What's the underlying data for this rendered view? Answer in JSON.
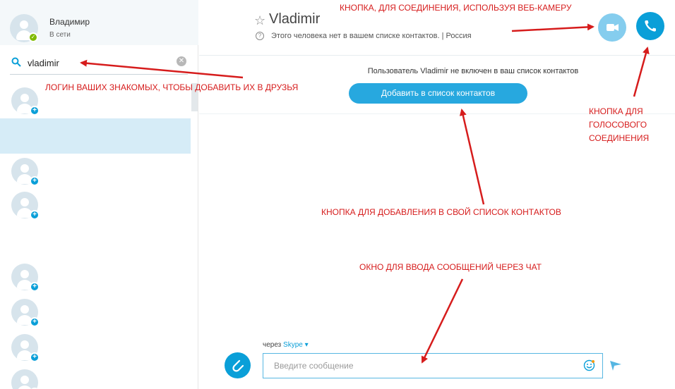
{
  "sidebar": {
    "profile": {
      "name": "Владимир",
      "status": "В сети"
    },
    "search": {
      "value": "vladimir",
      "placeholder": ""
    }
  },
  "header": {
    "contact_name": "Vladimir",
    "subtitle": "Этого человека нет в вашем списке контактов. | Россия"
  },
  "notice": {
    "text": "Пользователь Vladimir не включен в ваш список контактов",
    "add_button": "Добавить в список контактов"
  },
  "compose": {
    "via_prefix": "через",
    "via_service": "Skype",
    "placeholder": "Введите сообщение"
  },
  "annotations": {
    "video_button": "КНОПКА, ДЛЯ СОЕДИНЕНИЯ, ИСПОЛЬЗУЯ ВЕБ-КАМЕРУ",
    "search_login": "ЛОГИН ВАШИХ ЗНАКОМЫХ, ЧТОБЫ ДОБАВИТЬ ИХ В ДРУЗЬЯ",
    "voice_line1": "КНОПКА ДЛЯ",
    "voice_line2": "ГОЛОСОВОГО",
    "voice_line3": "СОЕДИНЕНИЯ",
    "add_contact": "КНОПКА ДЛЯ ДОБАВЛЕНИЯ В СВОЙ СПИСОК КОНТАКТОВ",
    "chat_window": "ОКНО ДЛЯ ВВОДА СООБЩЕНИЙ ЧЕРЕЗ ЧАТ"
  },
  "colors": {
    "accent": "#0a9fd8",
    "annotation": "#d61c1c",
    "online": "#7fba00",
    "selected_row": "#d6ecf7"
  },
  "icons": [
    "search-icon",
    "clear-icon",
    "star-icon",
    "help-icon",
    "video-icon",
    "phone-icon",
    "paperclip-icon",
    "smile-icon",
    "send-icon",
    "add-contact-icon"
  ]
}
